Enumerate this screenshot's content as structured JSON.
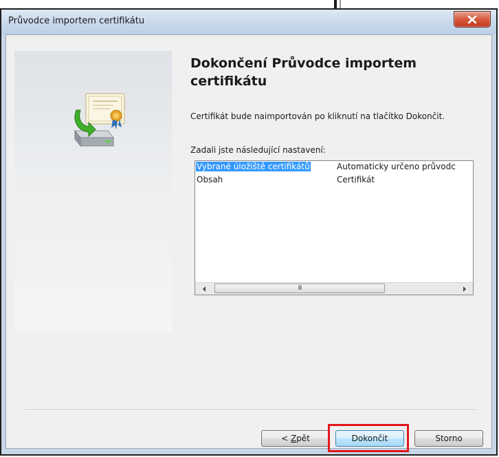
{
  "window": {
    "title": "Průvodce importem certifikátu"
  },
  "page": {
    "heading": "Dokončení Průvodce importem certifikátu",
    "description": "Certifikát bude naimportován po kliknutí na tlačítko Dokončit.",
    "settings_label": "Zadali jste následující nastavení:"
  },
  "settings": [
    {
      "name": "Vybrané úložiště certifikátů",
      "value": "Automaticky určeno průvodc"
    },
    {
      "name": "Obsah",
      "value": "Certifikát"
    }
  ],
  "scrollbar": {
    "thumb_grip": "III"
  },
  "buttons": {
    "back_prefix": "< ",
    "back_mnemonic": "Z",
    "back_rest": "pět",
    "finish": "Dokončit",
    "cancel": "Storno"
  },
  "colors": {
    "selection": "#3399ff",
    "highlight_box": "#e2161b",
    "close_button": "#c2381c"
  },
  "icons": {
    "close": "close-icon",
    "wizard": "certificate-import-icon"
  }
}
